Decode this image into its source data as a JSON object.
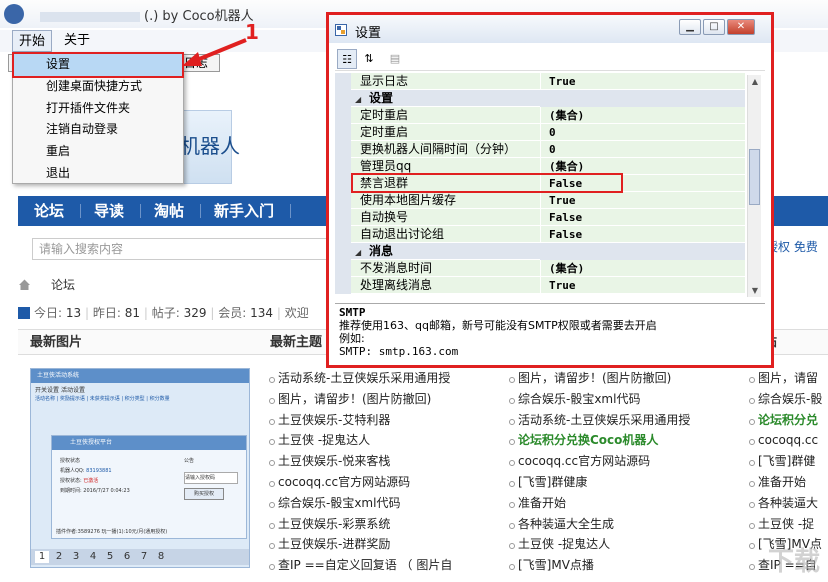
{
  "window": {
    "title": "(.) by Coco机器人"
  },
  "menubar": {
    "start": "开始",
    "about": "关于"
  },
  "tabs": [
    "",
    "日志"
  ],
  "start_menu": {
    "items": [
      "设置",
      "创建桌面快捷方式",
      "打开插件文件夹",
      "注销自动登录",
      "重启",
      "退出"
    ],
    "selected": "设置"
  },
  "annotation": {
    "number": "1"
  },
  "banner": {
    "text": "机器人"
  },
  "site_nav": {
    "items": [
      "论坛",
      "导读",
      "淘帖",
      "新手入门"
    ]
  },
  "search": {
    "placeholder": "请输入搜索内容"
  },
  "right_links": "授权 免费",
  "breadcrumb": {
    "current": "论坛"
  },
  "stats": {
    "today_label": "今日:",
    "today": "13",
    "yesterday_label": "昨日:",
    "yesterday": "81",
    "posts_label": "帖子:",
    "posts": "329",
    "members_label": "会员:",
    "members": "134",
    "welcome": "欢迎"
  },
  "sections": {
    "latest_images": "最新图片",
    "latest_topics": "最新主题",
    "right_cut": "帖"
  },
  "thumbnail": {
    "title": "土豆侠活动系统",
    "tabs": [
      "开关设置",
      "活动设置"
    ],
    "subtabs": [
      "活动名称",
      "奖励提示语",
      "未获奖提示语",
      "积分类型",
      "积分数量"
    ],
    "platform": "土豆侠授权平台",
    "auth_status": "授权状态",
    "machine_label": "机器人QQ:",
    "machine_qq": "83193881",
    "auth_label": "授权状态:",
    "auth_value": "已激活",
    "expire_label": "到期时间:",
    "expire_value": "2016/7/27 0:04:23",
    "notice": "公告",
    "input_placeholder": "请输入授权码",
    "buy_button": "购买授权",
    "footer": "插件作者:3589276  玩一播(1):10元/月(通用授权)",
    "pages": [
      "1",
      "2",
      "3",
      "4",
      "5",
      "6",
      "7",
      "8"
    ]
  },
  "topics_col1": [
    "活动系统-土豆侠娱乐采用通用授",
    "图片，请留步！(图片防撤回)",
    "土豆侠娱乐-艾特利器",
    "土豆侠 -捉鬼达人",
    "土豆侠娱乐-悦来客栈",
    "cocoqq.cc官方网站源码",
    "综合娱乐-骰宝xml代码",
    "土豆侠娱乐-彩票系统",
    "土豆侠娱乐-进群奖励",
    "查IP ==自定义回复语 （ 图片自"
  ],
  "topics_col2": [
    "图片，请留步！(图片防撤回)",
    "综合娱乐-骰宝xml代码",
    "活动系统-土豆侠娱乐采用通用授",
    "论坛积分兑换Coco机器人",
    "cocoqq.cc官方网站源码",
    "[飞雪]群健康",
    "准备开始",
    "各种装逼大全生成",
    "土豆侠 -捉鬼达人",
    "[飞雪]MV点播"
  ],
  "topics_col3": [
    "图片，请留",
    "综合娱乐-骰",
    "论坛积分兑",
    "cocoqq.cc",
    "[飞雪]群健",
    "准备开始",
    "各种装逼大",
    "土豆侠 -捉",
    "[飞雪]MV点",
    "查IP ==自"
  ],
  "settings": {
    "title": "设置",
    "rows": [
      {
        "key": "显示日志",
        "value": "True"
      },
      {
        "key": "设置",
        "category": true
      },
      {
        "key": "定时重启",
        "value": "(集合)"
      },
      {
        "key": "定时重启",
        "value": "0"
      },
      {
        "key": "更换机器人间隔时间（分钟）",
        "value": "0"
      },
      {
        "key": "管理员qq",
        "value": "(集合)"
      },
      {
        "key": "禁言退群",
        "value": "False"
      },
      {
        "key": "使用本地图片缓存",
        "value": "True"
      },
      {
        "key": "自动换号",
        "value": "False"
      },
      {
        "key": "自动退出讨论组",
        "value": "False"
      },
      {
        "key": "消息",
        "category": true
      },
      {
        "key": "不发消息时间",
        "value": "(集合)"
      },
      {
        "key": "处理离线消息",
        "value": "True"
      }
    ],
    "description": {
      "title": "SMTP",
      "line1": "推荐使用163、qq邮箱，新号可能没有SMTP权限或者需要去开启",
      "line2": "例如:",
      "line3": "SMTP: smtp.163.com"
    }
  },
  "watermark": "下载"
}
